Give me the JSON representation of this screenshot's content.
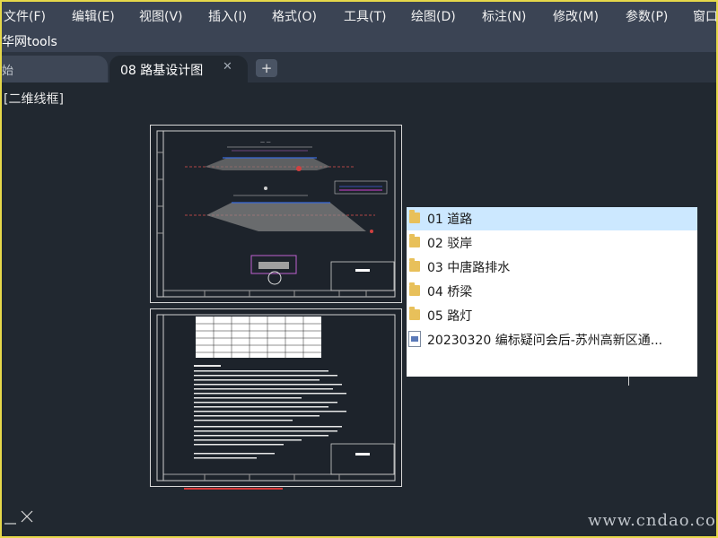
{
  "menubar": {
    "items": [
      "文件(F)",
      "编辑(E)",
      "视图(V)",
      "插入(I)",
      "格式(O)",
      "工具(T)",
      "绘图(D)",
      "标注(N)",
      "修改(M)",
      "参数(P)",
      "窗口"
    ]
  },
  "toolbar": {
    "label": "华网tools"
  },
  "tabs": {
    "inactive_label": "始",
    "active_label": "08 路基设计图",
    "close_glyph": "✕",
    "add_glyph": "+"
  },
  "viewport": {
    "view_label": "[二维线框]"
  },
  "popup": {
    "items": [
      {
        "label": "01 道路",
        "icon": "folder-icon",
        "selected": true
      },
      {
        "label": "02 驳岸",
        "icon": "folder-icon"
      },
      {
        "label": "03 中唐路排水",
        "icon": "folder-icon"
      },
      {
        "label": "04 桥梁",
        "icon": "folder-icon"
      },
      {
        "label": "05 路灯",
        "icon": "folder-icon"
      },
      {
        "label": "20230320 编标疑问会后-苏州高新区通...",
        "icon": "document-icon"
      }
    ]
  },
  "watermark": "www.cndao.com",
  "colors": {
    "canvas": "#212830",
    "menubar": "#3b4454",
    "frame": "#e6d84a",
    "selection": "#cce8ff"
  }
}
